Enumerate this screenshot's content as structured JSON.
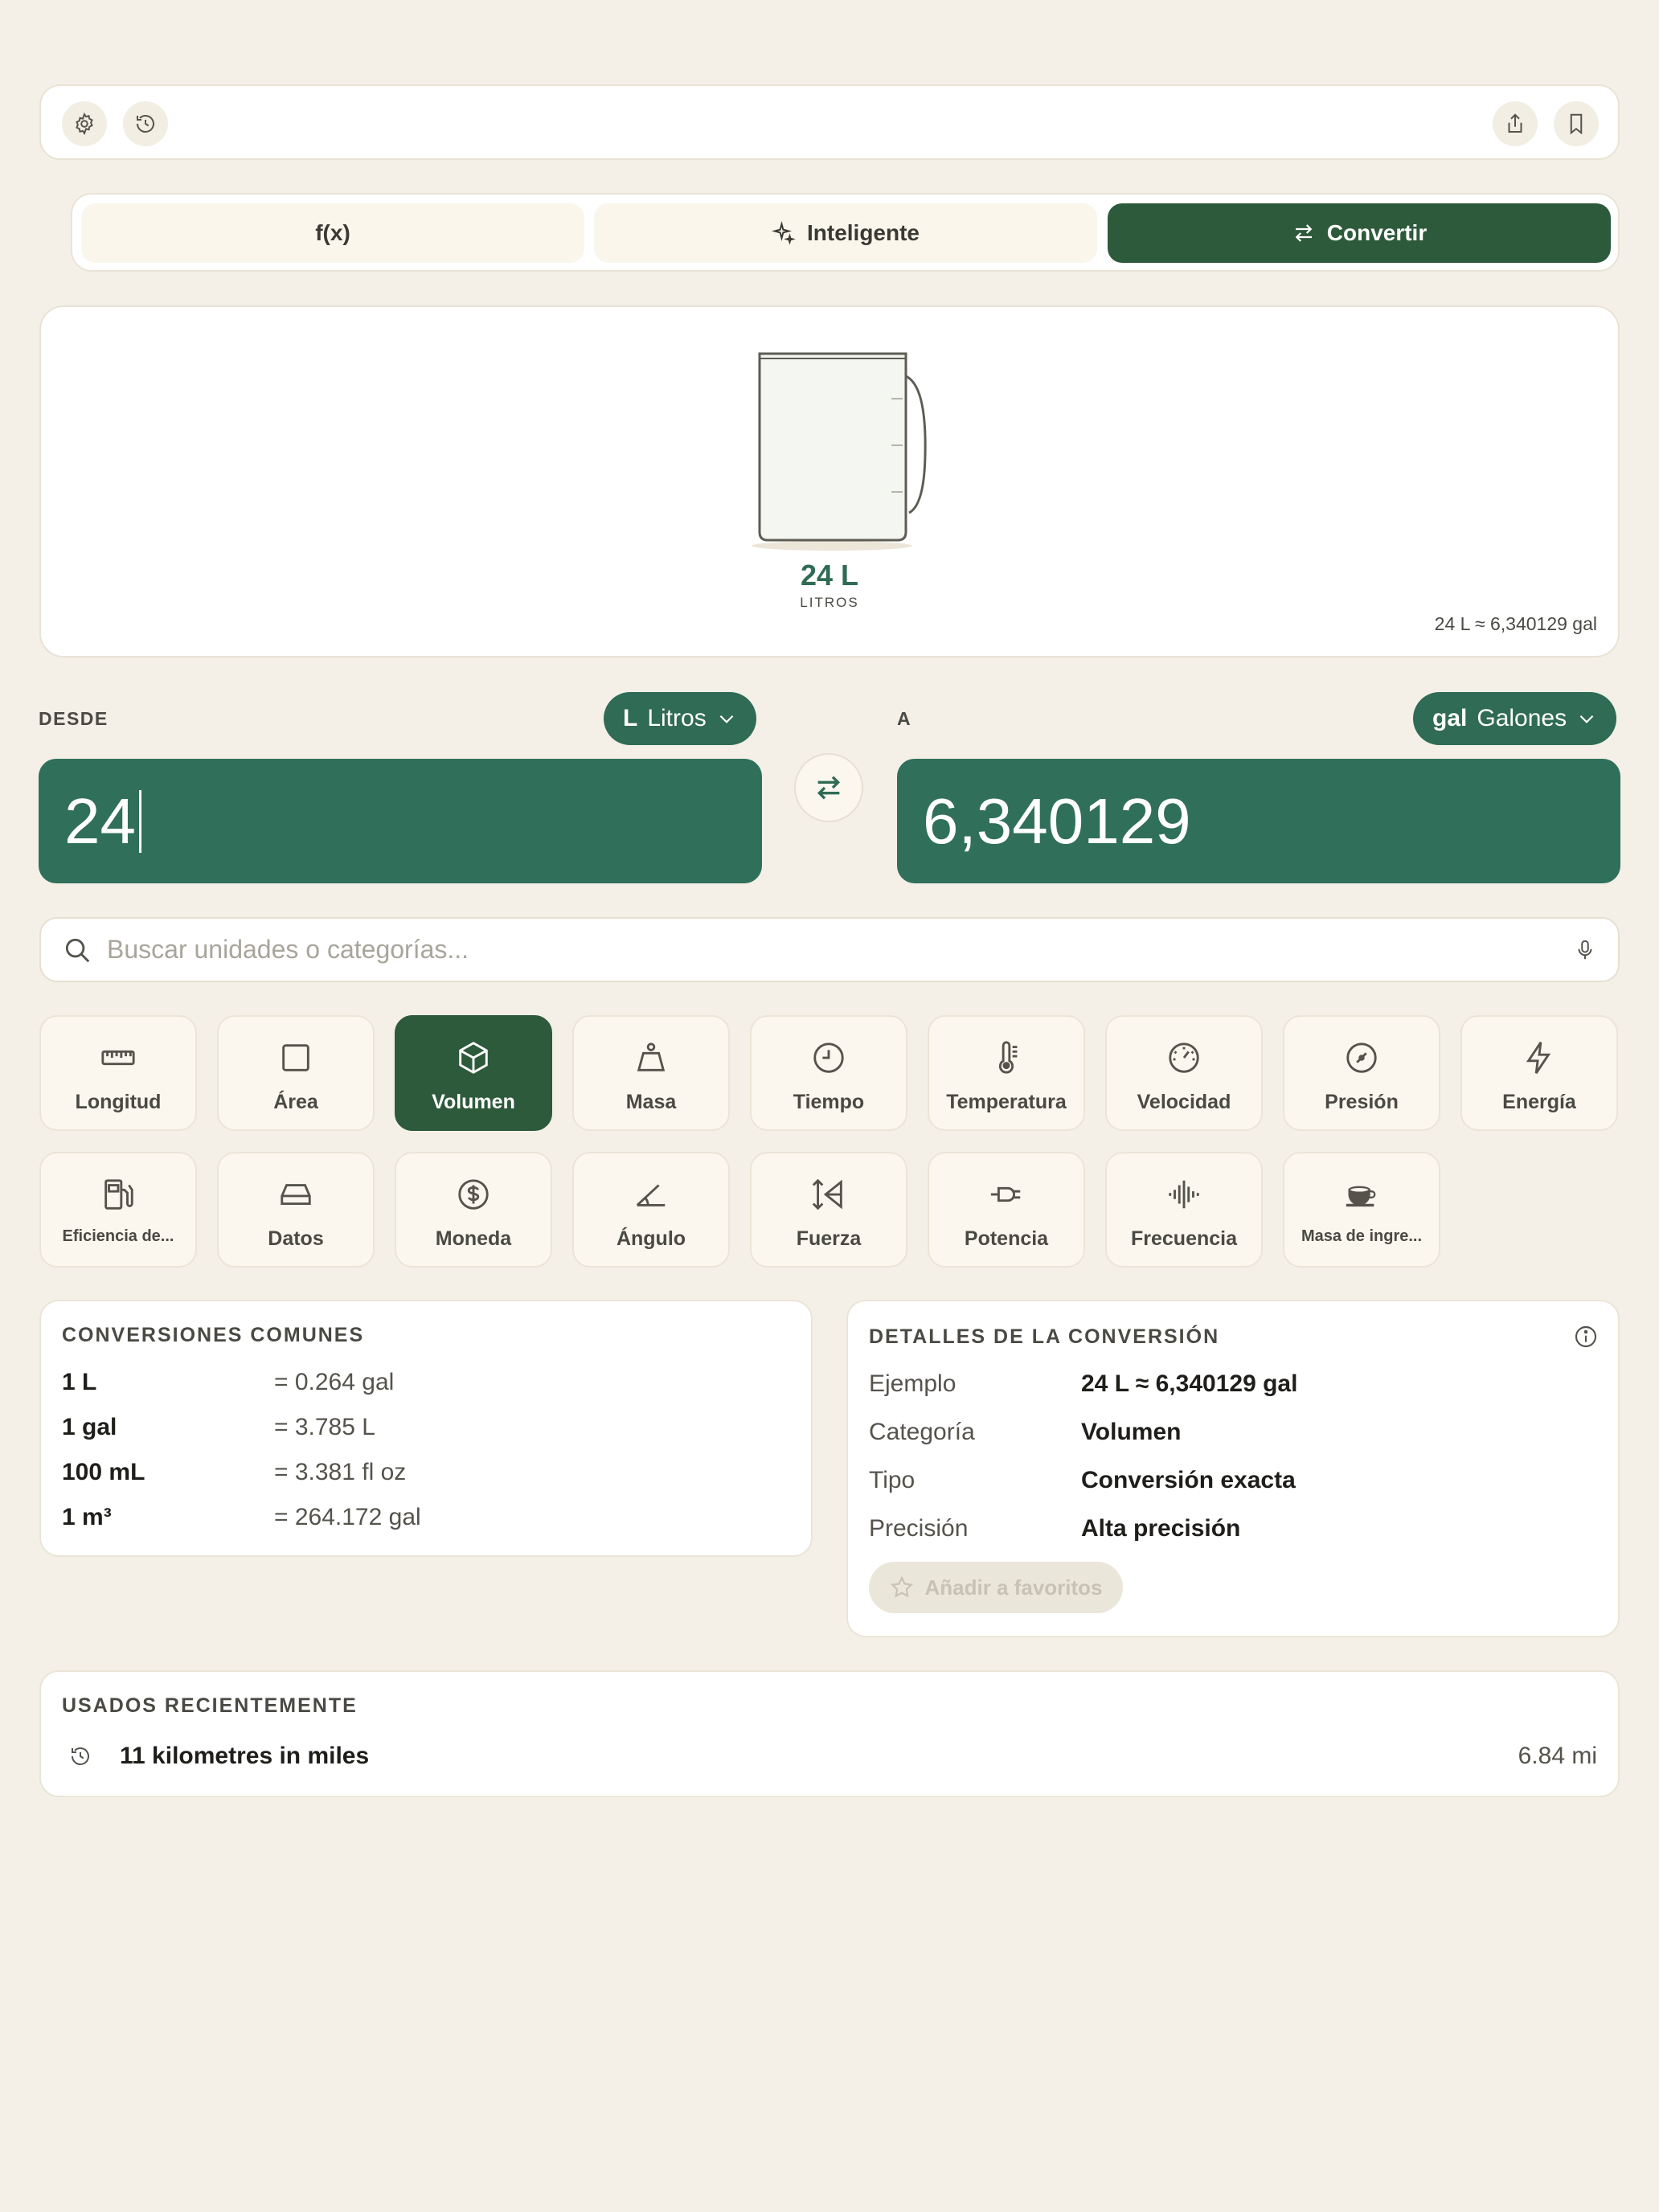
{
  "toolbar": {
    "left_icons": [
      "gear-icon",
      "history-icon"
    ],
    "right_icons": [
      "share-icon",
      "bookmark-icon"
    ]
  },
  "modes": {
    "tabs": [
      {
        "label": "f(x)",
        "icon": ""
      },
      {
        "label": "Inteligente",
        "icon": "sparkle-icon"
      },
      {
        "label": "Convertir",
        "icon": "swap-icon"
      }
    ],
    "active": "Convertir"
  },
  "visual": {
    "value": "24 L",
    "unit": "LITROS",
    "approx": "24 L ≈ 6,340129 gal",
    "icon": "measuring-jug-icon"
  },
  "from": {
    "label": "DESDE",
    "unit_symbol": "L",
    "unit_name": "Litros",
    "value": "24"
  },
  "to": {
    "label": "A",
    "unit_symbol": "gal",
    "unit_name": "Galones",
    "value": "6,340129"
  },
  "search": {
    "placeholder": "Buscar unidades o categorías..."
  },
  "categories": [
    {
      "label": "Longitud",
      "icon": "ruler-icon"
    },
    {
      "label": "Área",
      "icon": "square-icon"
    },
    {
      "label": "Volumen",
      "icon": "cube-icon",
      "active": true
    },
    {
      "label": "Masa",
      "icon": "weight-icon"
    },
    {
      "label": "Tiempo",
      "icon": "clock-icon"
    },
    {
      "label": "Temperatura",
      "icon": "thermometer-icon"
    },
    {
      "label": "Velocidad",
      "icon": "speedometer-icon"
    },
    {
      "label": "Presión",
      "icon": "gauge-icon"
    },
    {
      "label": "Energía",
      "icon": "bolt-icon"
    },
    {
      "label": "Eficiencia de...",
      "icon": "fuel-pump-icon"
    },
    {
      "label": "Datos",
      "icon": "drive-icon"
    },
    {
      "label": "Moneda",
      "icon": "dollar-icon"
    },
    {
      "label": "Ángulo",
      "icon": "angle-icon"
    },
    {
      "label": "Fuerza",
      "icon": "force-icon"
    },
    {
      "label": "Potencia",
      "icon": "plug-icon"
    },
    {
      "label": "Frecuencia",
      "icon": "waveform-icon"
    },
    {
      "label": "Masa de ingre...",
      "icon": "cup-icon"
    }
  ],
  "common": {
    "title": "CONVERSIONES COMUNES",
    "rows": [
      {
        "k": "1 L",
        "v": "= 0.264 gal"
      },
      {
        "k": "1 gal",
        "v": "= 3.785 L"
      },
      {
        "k": "100 mL",
        "v": "= 3.381 fl oz"
      },
      {
        "k": "1 m³",
        "v": "= 264.172 gal"
      }
    ]
  },
  "details": {
    "title": "DETALLES DE LA CONVERSIÓN",
    "rows": [
      {
        "k": "Ejemplo",
        "v": "24 L ≈ 6,340129 gal"
      },
      {
        "k": "Categoría",
        "v": "Volumen"
      },
      {
        "k": "Tipo",
        "v": "Conversión exacta"
      },
      {
        "k": "Precisión",
        "v": "Alta precisión"
      }
    ],
    "favorite_label": "Añadir a favoritos"
  },
  "recent": {
    "title": "USADOS RECIENTEMENTE",
    "items": [
      {
        "query": "11 kilometres in miles",
        "result": "6.84 mi"
      }
    ]
  },
  "colors": {
    "background": "#f4f0e8",
    "accent_dark": "#2d5a3a",
    "accent": "#30705b"
  }
}
